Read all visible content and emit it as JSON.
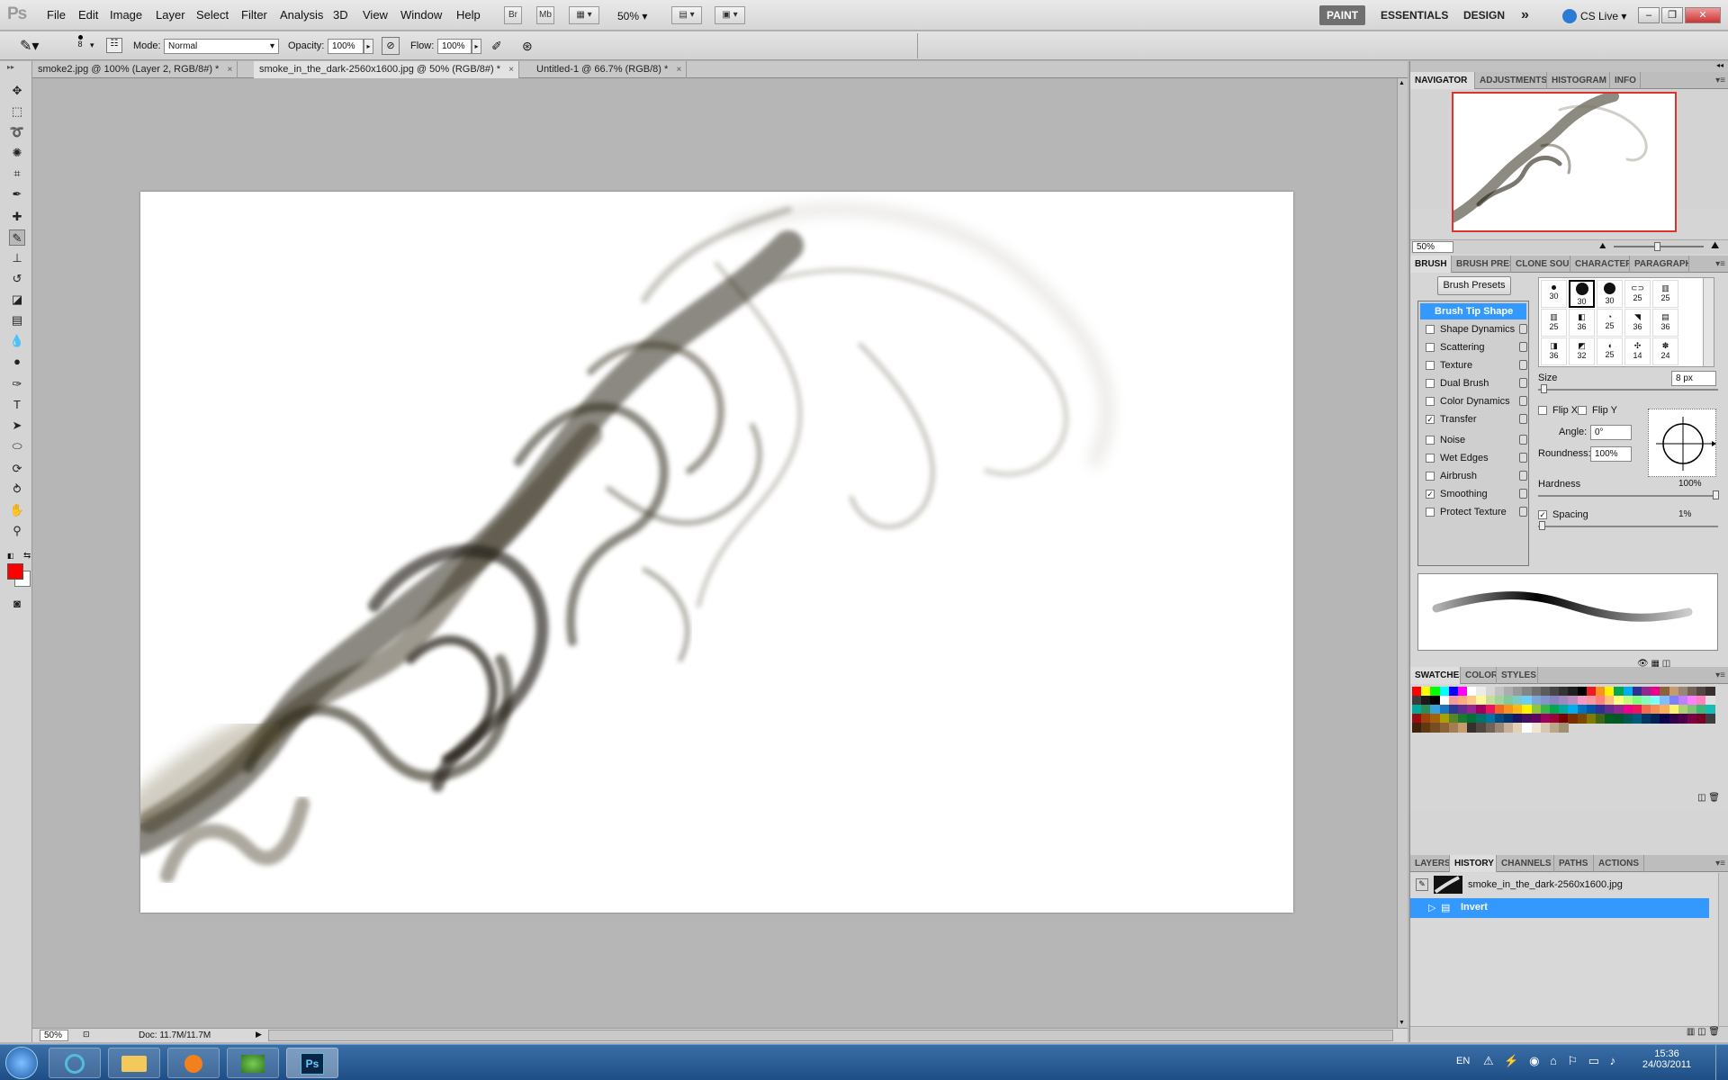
{
  "app": {
    "logo": "Ps"
  },
  "menu": [
    "File",
    "Edit",
    "Image",
    "Layer",
    "Select",
    "Filter",
    "Analysis",
    "3D",
    "View",
    "Window",
    "Help"
  ],
  "menubar_buttons": {
    "bridge": "Br",
    "mini_bridge": "Mb",
    "zoom": "50%"
  },
  "workspaces": {
    "paint": "PAINT",
    "essentials": "ESSENTIALS",
    "design": "DESIGN",
    "more": "»",
    "cs_live": "CS Live"
  },
  "options": {
    "brush_size": "8",
    "mode_label": "Mode:",
    "mode_value": "Normal",
    "opacity_label": "Opacity:",
    "opacity_value": "100%",
    "flow_label": "Flow:",
    "flow_value": "100%"
  },
  "tabs": [
    {
      "label": "smoke2.jpg @ 100% (Layer 2, RGB/8#) *",
      "close": "×"
    },
    {
      "label": "smoke_in_the_dark-2560x1600.jpg @ 50% (RGB/8#) *",
      "close": "×"
    },
    {
      "label": "Untitled-1 @ 66.7% (RGB/8) *",
      "close": "×"
    }
  ],
  "statusbar": {
    "zoom": "50%",
    "doc": "Doc: 11.7M/11.7M"
  },
  "navigator": {
    "tabs": [
      "NAVIGATOR",
      "ADJUSTMENTS",
      "HISTOGRAM",
      "INFO"
    ],
    "zoom": "50%",
    "slider_level": 0.5
  },
  "brush_panel": {
    "tabs": [
      "BRUSH",
      "BRUSH PRESETS",
      "CLONE SOURCE",
      "CHARACTER",
      "PARAGRAPH"
    ],
    "presets_button": "Brush Presets",
    "options": [
      {
        "label": "Brush Tip Shape",
        "checked": false,
        "selected": true
      },
      {
        "label": "Shape Dynamics",
        "checked": false
      },
      {
        "label": "Scattering",
        "checked": false
      },
      {
        "label": "Texture",
        "checked": false
      },
      {
        "label": "Dual Brush",
        "checked": false
      },
      {
        "label": "Color Dynamics",
        "checked": false
      },
      {
        "label": "Transfer",
        "checked": true
      },
      {
        "label": "Noise",
        "checked": false
      },
      {
        "label": "Wet Edges",
        "checked": false
      },
      {
        "label": "Airbrush",
        "checked": false
      },
      {
        "label": "Smoothing",
        "checked": true
      },
      {
        "label": "Protect Texture",
        "checked": false
      }
    ],
    "tip_sizes": [
      "30",
      "30",
      "30",
      "25",
      "25",
      "25",
      "36",
      "25",
      "36",
      "36",
      "36",
      "32",
      "25",
      "14",
      "24"
    ],
    "size_label": "Size",
    "size_value": "8 px",
    "flip_x": "Flip X",
    "flip_y": "Flip Y",
    "angle_label": "Angle:",
    "angle_value": "0°",
    "roundness_label": "Roundness:",
    "roundness_value": "100%",
    "hardness_label": "Hardness",
    "hardness_value": "100%",
    "spacing_label": "Spacing",
    "spacing_value": "1%"
  },
  "swatches_panel": {
    "tabs": [
      "SWATCHES",
      "COLOR",
      "STYLES"
    ]
  },
  "history_panel": {
    "tabs": [
      "LAYERS",
      "HISTORY",
      "CHANNELS",
      "PATHS",
      "ACTIONS"
    ],
    "snapshot": "smoke_in_the_dark-2560x1600.jpg",
    "steps": [
      "Invert"
    ]
  },
  "taskbar": {
    "lang": "EN",
    "time": "15:36",
    "date": "24/03/2011"
  },
  "colors": {
    "foreground": "#ff0000",
    "background": "#ffffff",
    "accent": "#3399ff",
    "smoke": "#3a3220"
  }
}
